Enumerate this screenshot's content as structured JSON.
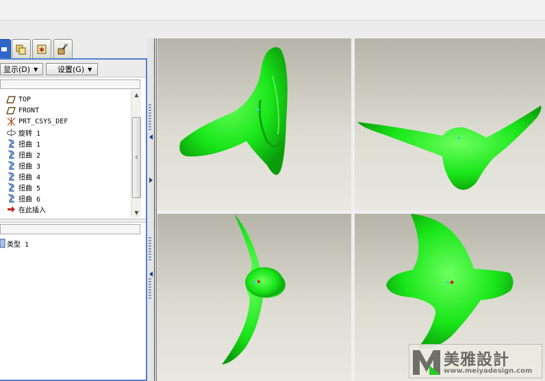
{
  "toolbar": {
    "display_menu": "显示(D)",
    "settings_menu": "设置(G)"
  },
  "model_tree": {
    "items": [
      {
        "label": "TOP",
        "icon": "datum-plane-icon"
      },
      {
        "label": "FRONT",
        "icon": "datum-plane-icon"
      },
      {
        "label": "PRT_CSYS_DEF",
        "icon": "coordinate-system-icon"
      },
      {
        "label": "旋转 1",
        "icon": "revolve-feature-icon"
      },
      {
        "label": "扭曲 1",
        "icon": "warp-feature-icon"
      },
      {
        "label": "扭曲 2",
        "icon": "warp-feature-icon"
      },
      {
        "label": "扭曲 3",
        "icon": "warp-feature-icon"
      },
      {
        "label": "扭曲 4",
        "icon": "warp-feature-icon"
      },
      {
        "label": "扭曲 5",
        "icon": "warp-feature-icon"
      },
      {
        "label": "扭曲 6",
        "icon": "warp-feature-icon"
      },
      {
        "label": "在此插入",
        "icon": "insert-here-arrow-icon"
      }
    ]
  },
  "layer_tree": {
    "items": [
      {
        "label": "类型 1"
      }
    ]
  },
  "colors": {
    "model_green": "#19e619",
    "panel_border": "#4f7fd4",
    "active_tab": "#2f67c9"
  },
  "watermark": {
    "brand": "美雅設計",
    "url": "www.meiyadesign.com"
  }
}
